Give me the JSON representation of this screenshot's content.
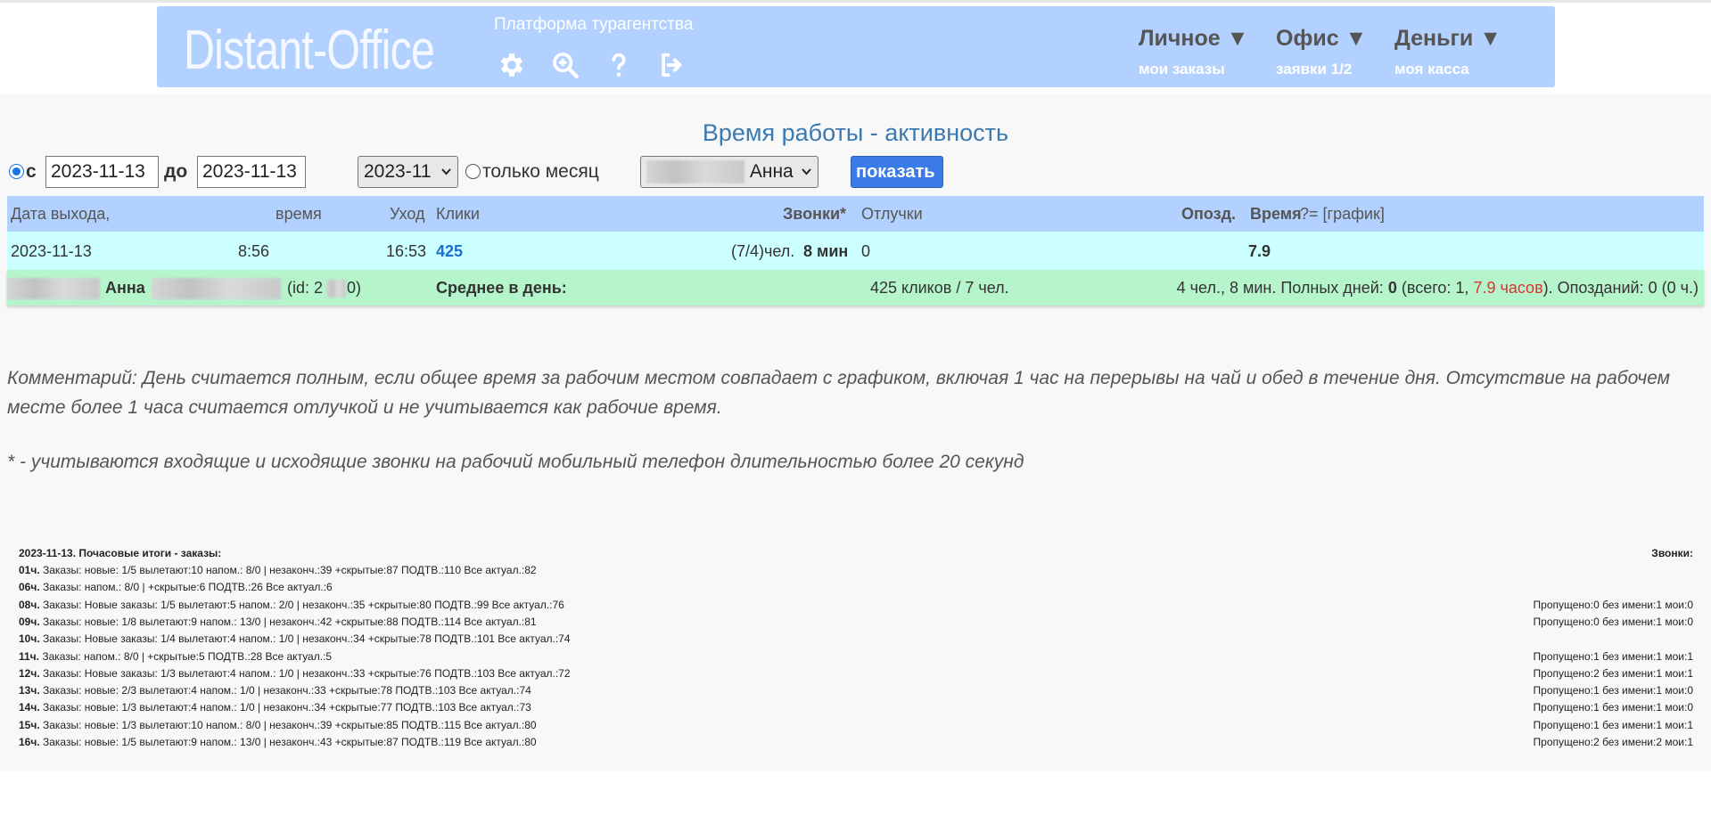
{
  "header": {
    "logo": "Distant-Office",
    "platform": "Платформа турагентства",
    "icons": [
      "gear-icon",
      "zoom-icon",
      "help-icon",
      "logout-icon"
    ],
    "nav": [
      {
        "title": "Личное ▼",
        "sub": "мои заказы"
      },
      {
        "title": "Офис ▼",
        "sub": "заявки 1/2"
      },
      {
        "title": "Деньги ▼",
        "sub": "моя касса"
      }
    ]
  },
  "page": {
    "title": "Время работы - активность"
  },
  "filters": {
    "from_label": "с",
    "from_value": "2023-11-13",
    "to_label": "до",
    "to_value": "2023-11-13",
    "month_value": "2023-11",
    "month_only_label": "только месяц",
    "user_value": "Анна",
    "show_button": "показать"
  },
  "table": {
    "headers": {
      "date": "Дата выхода,",
      "time": "время",
      "leave": "Уход",
      "clicks": "Клики",
      "calls": "Звонки*",
      "absences": "Отлучки",
      "late": "Опозд.",
      "worktime": "Время",
      "worktime_suffix": "?= [график]"
    },
    "row": {
      "date": "2023-11-13",
      "time": "8:56",
      "leave": "16:53",
      "clicks": "425",
      "calls_count": "(7/4)чел.",
      "calls_dur": "8 мин",
      "absences": "0",
      "late": "",
      "worktime": "7.9"
    },
    "total": {
      "name": "Анна",
      "id_prefix": "(id: 2",
      "id_suffix": "0)",
      "avg_label": "Среднее в день:",
      "clicks_summary": "425 кликов / 7 чел.",
      "summary_a": "4 чел., 8 мин. Полных дней:",
      "full_days": "0",
      "summary_b": "(всего: 1,",
      "hours": "7.9 часов",
      "summary_c": "). Опозданий: 0 (0 ч.)"
    }
  },
  "comment": "Комментарий: День считается полным, если общее время за рабочим местом совпадает с графиком, включая 1 час на перерывы на чай и обед в течение дня. Отсутствие на рабочем месте более 1 часа считается отлучкой и не учитывается как рабочие время.",
  "note": "* - учитываются входящие и исходящие звонки на рабочий мобильный телефон длительностью более 20 секунд",
  "hourly": {
    "title": "2023-11-13. Почасовые итоги - заказы:",
    "calls_title": "Звонки:",
    "lines": [
      {
        "hour": "01ч.",
        "text": " Заказы: новые: 1/5 вылетают:10 напом.: 8/0 | незаконч.:39 +скрытые:87 ПОДТВ.:110 Все актуал.:82",
        "calls": ""
      },
      {
        "hour": "06ч.",
        "text": " Заказы: напом.: 8/0 | +скрытые:6 ПОДТВ.:26 Все актуал.:6",
        "calls": ""
      },
      {
        "hour": "08ч.",
        "text": " Заказы: Новые заказы: 1/5 вылетают:5 напом.: 2/0 | незаконч.:35 +скрытые:80 ПОДТВ.:99 Все актуал.:76",
        "calls": "Пропущено:0 без имени:1 мои:0"
      },
      {
        "hour": "09ч.",
        "text": " Заказы: новые: 1/8 вылетают:9 напом.: 13/0 | незаконч.:42 +скрытые:88 ПОДТВ.:114 Все актуал.:81",
        "calls": "Пропущено:0 без имени:1 мои:0"
      },
      {
        "hour": "10ч.",
        "text": " Заказы: Новые заказы: 1/4 вылетают:4 напом.: 1/0 | незаконч.:34 +скрытые:78 ПОДТВ.:101 Все актуал.:74",
        "calls": ""
      },
      {
        "hour": "11ч.",
        "text": " Заказы: напом.: 8/0 | +скрытые:5 ПОДТВ.:28 Все актуал.:5",
        "calls": "Пропущено:1 без имени:1 мои:1"
      },
      {
        "hour": "12ч.",
        "text": " Заказы: Новые заказы: 1/3 вылетают:4 напом.: 1/0 | незаконч.:33 +скрытые:76 ПОДТВ.:103 Все актуал.:72",
        "calls": "Пропущено:2 без имени:1 мои:1"
      },
      {
        "hour": "13ч.",
        "text": " Заказы: новые: 2/3 вылетают:4 напом.: 1/0 | незаконч.:33 +скрытые:78 ПОДТВ.:103 Все актуал.:74",
        "calls": "Пропущено:1 без имени:1 мои:0"
      },
      {
        "hour": "14ч.",
        "text": " Заказы: новые: 1/3 вылетают:4 напом.: 1/0 | незаконч.:34 +скрытые:77 ПОДТВ.:103 Все актуал.:73",
        "calls": "Пропущено:1 без имени:1 мои:0"
      },
      {
        "hour": "15ч.",
        "text": " Заказы: новые: 1/3 вылетают:10 напом.: 8/0 | незаконч.:39 +скрытые:85 ПОДТВ.:115 Все актуал.:80",
        "calls": "Пропущено:1 без имени:1 мои:1"
      },
      {
        "hour": "16ч.",
        "text": " Заказы: новые: 1/5 вылетают:9 напом.: 13/0 | незаконч.:43 +скрытые:87 ПОДТВ.:119 Все актуал.:80",
        "calls": "Пропущено:2 без имени:2 мои:1"
      }
    ]
  },
  "colors": {
    "header_bg": "#b3d1ff",
    "data_row_bg": "#ccffff",
    "total_row_bg": "#b6f5cc",
    "title_blue": "#3a7ab0",
    "button_blue": "#3b7be8",
    "hours_red": "#e03030"
  }
}
